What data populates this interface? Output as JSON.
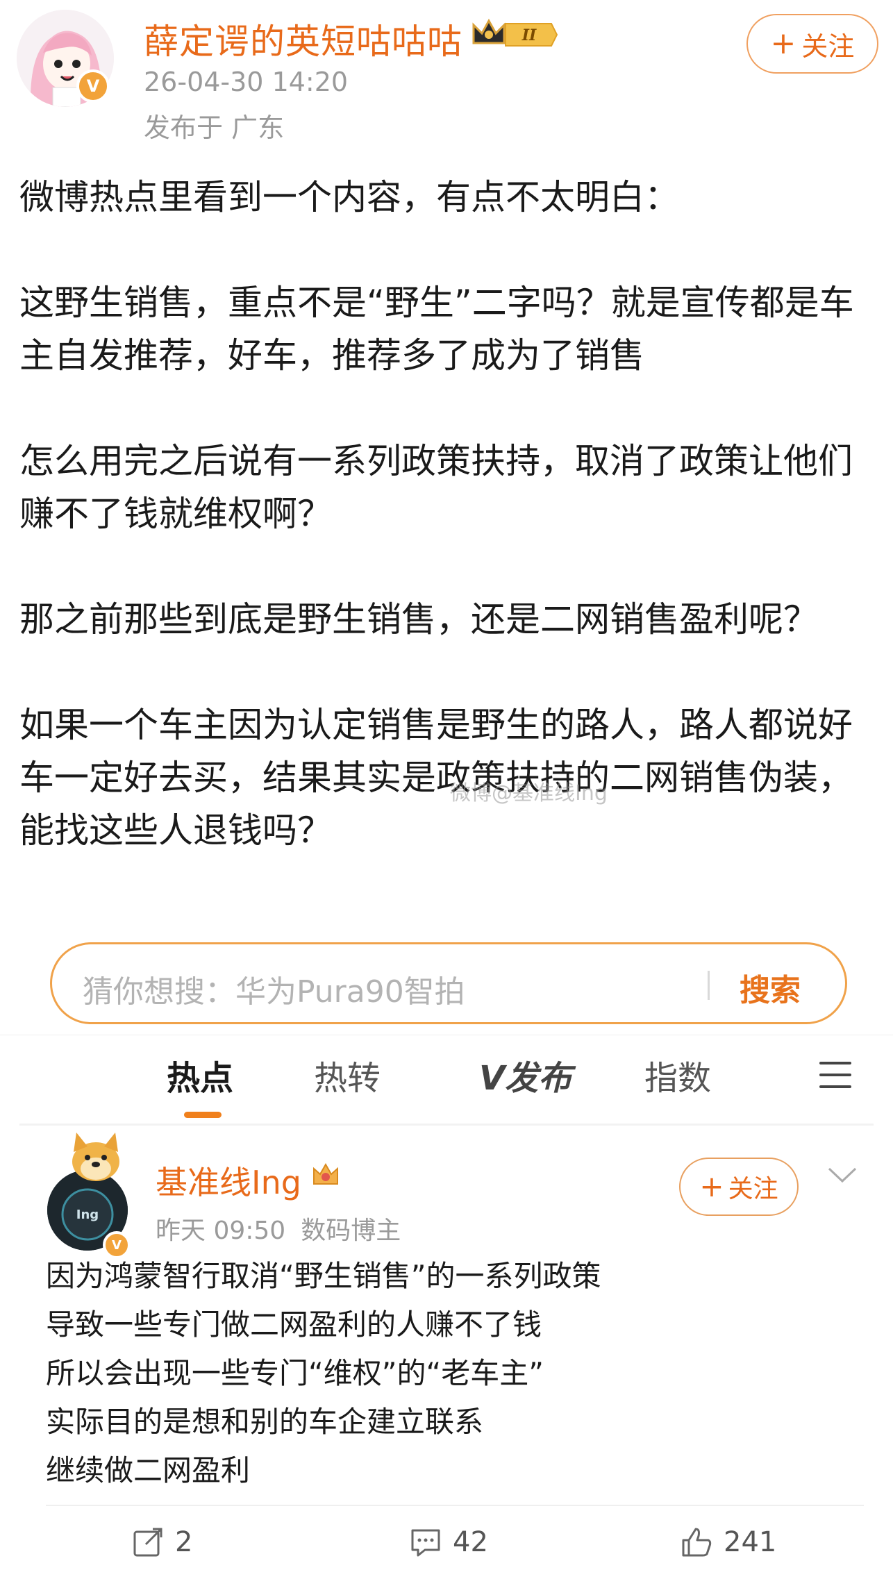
{
  "post": {
    "author": "薛定谔的英短咕咕咕",
    "time": "26-04-30 14:20",
    "location": "发布于 广东",
    "follow_label": "关注",
    "badge_level": "II",
    "paragraphs": [
      "微博热点里看到一个内容，有点不太明白：",
      "这野生销售，重点不是“野生”二字吗？就是宣传都是车主自发推荐，好车，推荐多了成为了销售",
      "怎么用完之后说有一系列政策扶持，取消了政策让他们赚不了钱就维权啊？",
      "那之前那些到底是野生销售，还是二网销售盈利呢？",
      "如果一个车主因为认定销售是野生的路人，路人都说好车一定好去买，结果其实是政策扶持的二网销售伪装，能找这些人退钱吗？"
    ],
    "watermark": "微博@基准线Ing"
  },
  "search": {
    "placeholder": "猜你想搜：华为Pura90智拍",
    "button": "搜索"
  },
  "tabs": [
    {
      "label": "热点",
      "active": true
    },
    {
      "label": "热转",
      "active": false
    },
    {
      "label": "V发布",
      "active": false
    },
    {
      "label": "指数",
      "active": false
    }
  ],
  "card": {
    "author": "基准线Ing",
    "time": "昨天 09:50",
    "role": "数码博主",
    "follow_label": "关注",
    "lines": [
      "因为鸿蒙智行取消“野生销售”的一系列政策",
      "导致一些专门做二网盈利的人赚不了钱",
      "所以会出现一些专门“维权”的“老车主”",
      "实际目的是想和别的车企建立联系",
      "继续做二网盈利"
    ],
    "actions": {
      "repost": "2",
      "comment": "42",
      "like": "241"
    }
  },
  "colors": {
    "accent": "#e86a1a",
    "search_border": "#f0a24a",
    "tab_indicator": "#f0801c"
  }
}
